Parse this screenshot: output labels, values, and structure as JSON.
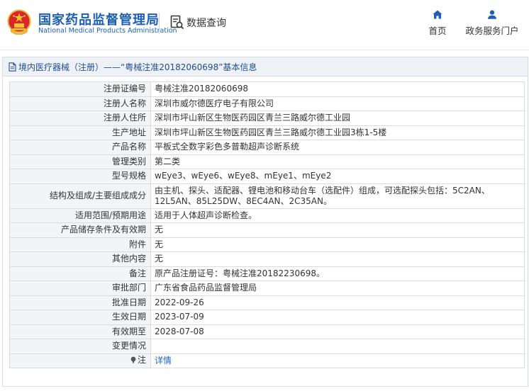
{
  "header": {
    "brand_cn": "国家药品监督管理局",
    "brand_en": "National Medical Products Administration",
    "query_label": "数据查询",
    "nav": [
      {
        "label": "首页",
        "icon": "home-icon"
      },
      {
        "label": "政务服务门户",
        "icon": "user-icon"
      }
    ]
  },
  "panel": {
    "title": "境内医疗器械（注册）——“粤械注准20182060698”基本信息"
  },
  "fields": [
    {
      "key": "注册证编号",
      "value": "粤械注准20182060698"
    },
    {
      "key": "注册人名称",
      "value": "深圳市威尔德医疗电子有限公司"
    },
    {
      "key": "注册人住所",
      "value": "深圳市坪山新区生物医药园区青兰三路威尔德工业园"
    },
    {
      "key": "生产地址",
      "value": "深圳市坪山新区生物医药园区青兰三路威尔德工业园3栋1-5楼"
    },
    {
      "key": "产品名称",
      "value": "平板式全数字彩色多普勒超声诊断系统"
    },
    {
      "key": "管理类别",
      "value": "第二类"
    },
    {
      "key": "型号规格",
      "value": "wEye3、wEye6、wEye8、mEye1、mEye2"
    },
    {
      "key": "结构及组成/主要组成成分",
      "value": "由主机、探头、适配器、锂电池和移动台车（选配件）组成，可选配探头包括：5C2AN、12L5AN、85L25DW、8EC4AN、2C35AN。"
    },
    {
      "key": "适用范围/预期用途",
      "value": "适用于人体超声诊断检查。"
    },
    {
      "key": "产品储存条件及有效期",
      "value": "无"
    },
    {
      "key": "附件",
      "value": "无"
    },
    {
      "key": "其他内容",
      "value": "无"
    },
    {
      "key": "备注",
      "value": "原产品注册证号：粤械注准20182230698。"
    },
    {
      "key": "审批部门",
      "value": "广东省食品药品监督管理局"
    },
    {
      "key": "批准日期",
      "value": "2022-09-26"
    },
    {
      "key": "生效日期",
      "value": "2023-07-09"
    },
    {
      "key": "有效期至",
      "value": "2028-07-08"
    },
    {
      "key": "变更情况",
      "value": ""
    },
    {
      "key": "注",
      "value": "详情",
      "link": true
    }
  ],
  "colors": {
    "brand": "#1e5fb3",
    "link": "#1e66c4",
    "key_bg": "#f2f4f7"
  }
}
